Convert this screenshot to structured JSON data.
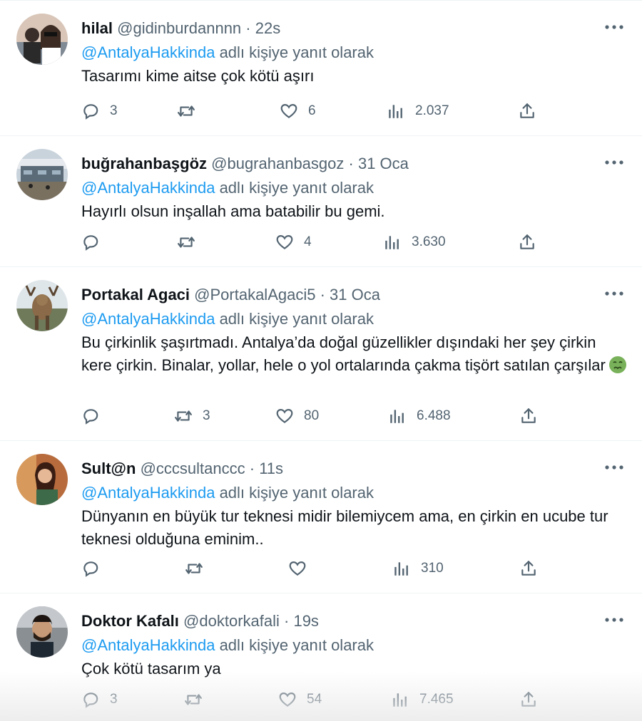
{
  "reply_prefix_suffix": "adlı kişiye yanıt olarak",
  "colors": {
    "mention": "#1d9bf0",
    "muted": "#536471",
    "text": "#0f1419"
  },
  "tweets": [
    {
      "name": "hilal",
      "handle": "@gidinburdannnn",
      "time": "22s",
      "reply_to": "@AntalyaHakkinda",
      "reply_suffix": "adlı kişiye yanıt olarak",
      "text": "Tasarımı kime aitse çok kötü aşırı",
      "replies": "3",
      "retweets": "",
      "likes": "6",
      "views": "2.037"
    },
    {
      "name": "buğrahanbaşgöz",
      "handle": "@bugrahanbasgoz",
      "time": "31 Oca",
      "reply_to": "@AntalyaHakkinda",
      "reply_suffix": "adlı kişiye yanıt olarak",
      "text": "Hayırlı olsun inşallah ama batabilir bu gemi.",
      "replies": "",
      "retweets": "",
      "likes": "4",
      "views": "3.630"
    },
    {
      "name": "Portakal Agaci",
      "handle": "@PortakalAgaci5",
      "time": "31 Oca",
      "reply_to": "@AntalyaHakkinda",
      "reply_suffix": "adlı kişiye yanıt olarak",
      "text": "Bu çirkinlik şaşırtmadı. Antalya’da doğal güzellikler dışındaki her şey çirkin kere çirkin. Binalar, yollar, hele o yol ortalarında çakma tişört satılan çarşılar",
      "emoji": "nauseated-face-icon",
      "replies": "",
      "retweets": "3",
      "likes": "80",
      "views": "6.488"
    },
    {
      "name": "Sult@n",
      "handle": "@cccsultanccc",
      "time": "11s",
      "reply_to": "@AntalyaHakkinda",
      "reply_suffix": "adlı kişiye yanıt olarak",
      "text": "Dünyanın en büyük tur teknesi midir bilemiycem ama, en çirkin en ucube tur teknesi olduğuna eminim..",
      "replies": "",
      "retweets": "",
      "likes": "",
      "views": "310"
    },
    {
      "name": "Doktor Kafalı",
      "handle": "@doktorkafali",
      "time": "19s",
      "reply_to": "@AntalyaHakkinda",
      "reply_suffix": "adlı kişiye yanıt olarak",
      "text": "Çok kötü tasarım ya",
      "replies": "3",
      "retweets": "",
      "likes": "54",
      "views": "7.465"
    }
  ]
}
